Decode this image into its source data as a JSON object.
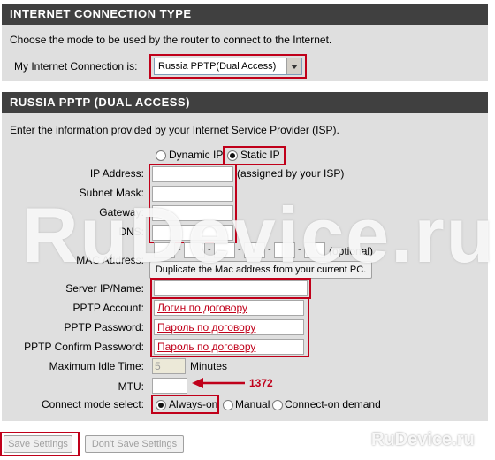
{
  "internet_section": {
    "title": "INTERNET CONNECTION TYPE",
    "description": "Choose the mode to be used by the router to connect to the Internet.",
    "connection_label": "My Internet Connection is:",
    "connection_value": "Russia PPTP(Dual Access)"
  },
  "pptp_section": {
    "title": "RUSSIA PPTP (DUAL ACCESS)",
    "description": "Enter the information provided by your Internet Service Provider (ISP).",
    "ip_mode": {
      "dynamic_label": "Dynamic IP",
      "static_label": "Static IP",
      "selected": "Static IP"
    },
    "fields": {
      "ip_address_label": "IP Address:",
      "ip_address_hint": "(assigned by your ISP)",
      "subnet_mask_label": "Subnet Mask:",
      "gateway_label": "Gateway:",
      "dns_label": "DNS:",
      "mac_label": "MAC Address:",
      "mac_separator": "-",
      "mac_hint": "(optional)",
      "mac_clone_button": "Duplicate the Mac address from your current PC.",
      "server_label": "Server IP/Name:",
      "account_label": "PPTP Account:",
      "account_value": "Логин по договору",
      "password_label": "PPTP Password:",
      "password_value": "Пароль по договору",
      "confirm_label": "PPTP Confirm Password:",
      "confirm_value": "Пароль по договору",
      "idle_label": "Maximum Idle Time:",
      "idle_value": "5",
      "idle_unit": "Minutes",
      "mtu_label": "MTU:",
      "mtu_annotation": "1372",
      "connect_label": "Connect mode select:",
      "connect_options": [
        "Always-on",
        "Manual",
        "Connect-on demand"
      ],
      "connect_selected": "Always-on"
    }
  },
  "footer": {
    "save_button": "Save Settings",
    "dont_save_button": "Don't Save Settings"
  },
  "watermark": {
    "main": "RuDevice.ru",
    "corner": "RuDevice.ru"
  },
  "colors": {
    "header_bg": "#404040",
    "body_bg": "#dfdfdf",
    "highlight_red": "#c0001a"
  }
}
